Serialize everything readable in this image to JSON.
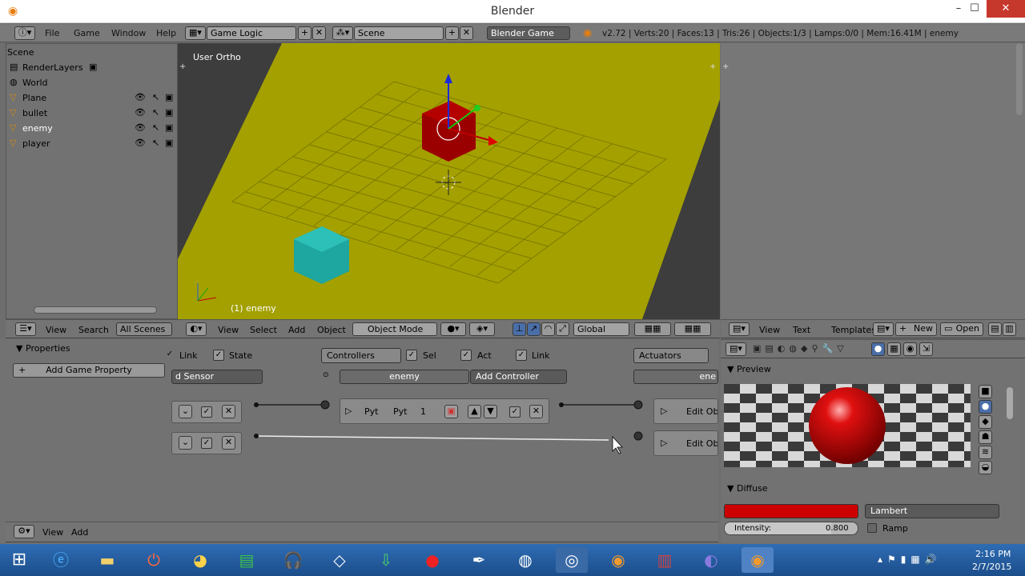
{
  "window": {
    "title": "Blender"
  },
  "menubar": {
    "items": [
      "File",
      "Game",
      "Window",
      "Help"
    ],
    "screen_layout": "Game Logic",
    "scene": "Scene",
    "engine": "Blender Game",
    "stats": "v2.72 | Verts:20 | Faces:13 | Tris:26 | Objects:1/3 | Lamps:0/0 | Mem:16.41M | enemy"
  },
  "outliner": {
    "title": "Scene",
    "items": [
      {
        "label": "RenderLayers"
      },
      {
        "label": "World"
      },
      {
        "label": "Plane"
      },
      {
        "label": "bullet"
      },
      {
        "label": "enemy"
      },
      {
        "label": "player"
      }
    ],
    "footer": {
      "view": "View",
      "search": "Search",
      "filter": "All Scenes"
    }
  },
  "viewport": {
    "label": "User Ortho",
    "object_label": "(1) enemy",
    "footer": {
      "view": "View",
      "select": "Select",
      "add": "Add",
      "object": "Object",
      "mode": "Object Mode",
      "orientation": "Global"
    }
  },
  "text_editor_footer": {
    "view": "View",
    "text": "Text",
    "templates": "Templates",
    "new": "New",
    "open": "Open"
  },
  "logic": {
    "properties_title": "Properties",
    "add_property": "Add Game Property",
    "sensors": {
      "link": "Link",
      "state": "State",
      "add_sensor": "d Sensor"
    },
    "controllers": {
      "menu": "Controllers",
      "sel": "Sel",
      "act": "Act",
      "link": "Link",
      "object": "enemy",
      "add": "Add Controller",
      "controller": {
        "type": "Pyt",
        "name": "Pyt",
        "index": "1"
      }
    },
    "actuators": {
      "menu": "Actuators",
      "object": "ene",
      "edit1": "Edit Obje",
      "edit2": "Edit Obje"
    },
    "footer": {
      "view": "View",
      "add": "Add"
    }
  },
  "properties": {
    "preview_title": "Preview",
    "diffuse_title": "Diffuse",
    "diffuse_color": "#cc0000",
    "shader": "Lambert",
    "intensity_label": "Intensity:",
    "intensity_value": "0.800",
    "ramp_label": "Ramp"
  },
  "taskbar": {
    "time": "2:16 PM",
    "date": "2/7/2015"
  }
}
